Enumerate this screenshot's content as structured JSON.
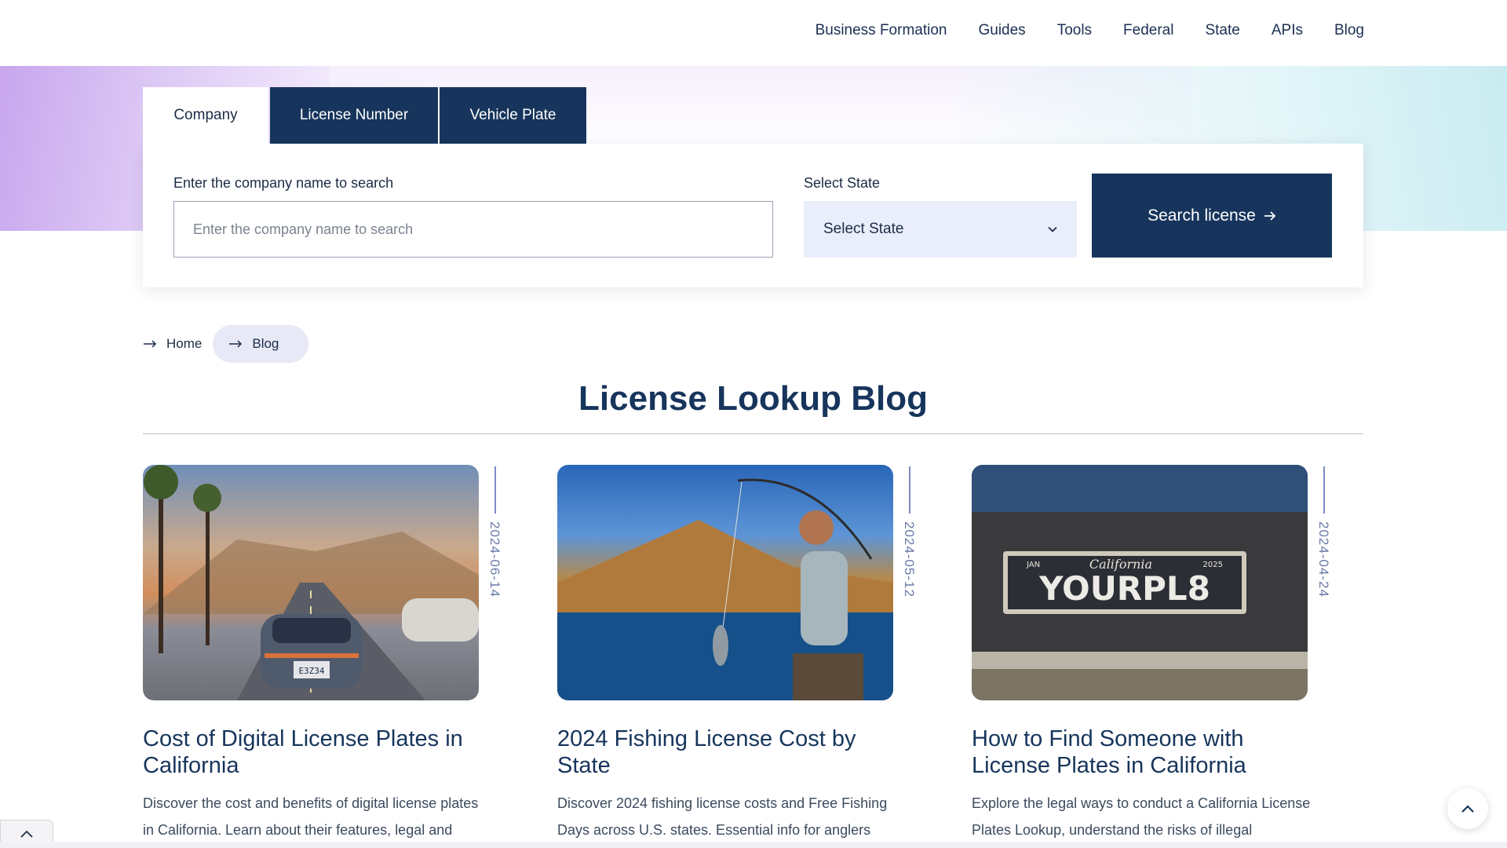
{
  "nav": {
    "items": [
      "Business Formation",
      "Guides",
      "Tools",
      "Federal",
      "State",
      "APIs",
      "Blog"
    ]
  },
  "search": {
    "tabs": [
      "Company",
      "License Number",
      "Vehicle Plate"
    ],
    "company_label": "Enter the company name to search",
    "company_placeholder": "Enter the company name to search",
    "state_label": "Select State",
    "state_value": "Select State",
    "button_label": "Search license"
  },
  "breadcrumb": {
    "items": [
      "Home",
      "Blog"
    ]
  },
  "page": {
    "title": "License Lookup Blog"
  },
  "posts": [
    {
      "date": "2024-06-14",
      "title": "Cost of Digital License Plates in California",
      "excerpt": "Discover the cost and benefits of digital license plates in California. Learn about their features, legal and"
    },
    {
      "date": "2024-05-12",
      "title": "2024 Fishing License Cost by State",
      "excerpt": "Discover 2024 fishing license costs and Free Fishing Days across U.S. states. Essential info for anglers planning trips."
    },
    {
      "date": "2024-04-24",
      "title": "How to Find Someone with License Plates in California",
      "excerpt": "Explore the legal ways to conduct a California License Plates Lookup, understand the risks of illegal"
    }
  ],
  "images": {
    "plate1_text": "E3Z34",
    "plate3_month": "JAN",
    "plate3_state": "California",
    "plate3_year": "2025",
    "plate3_number": "YOURPL8"
  },
  "colors": {
    "navy": "#17355c",
    "select_bg": "#eaeefb",
    "crumb_bg": "#e8e9f6"
  },
  "icons": {
    "dropdown": "chevron-down-icon",
    "search_arrow": "arrow-right-icon",
    "crumb_arrow": "arrow-right-icon",
    "scroll_top": "chevron-up-icon"
  }
}
